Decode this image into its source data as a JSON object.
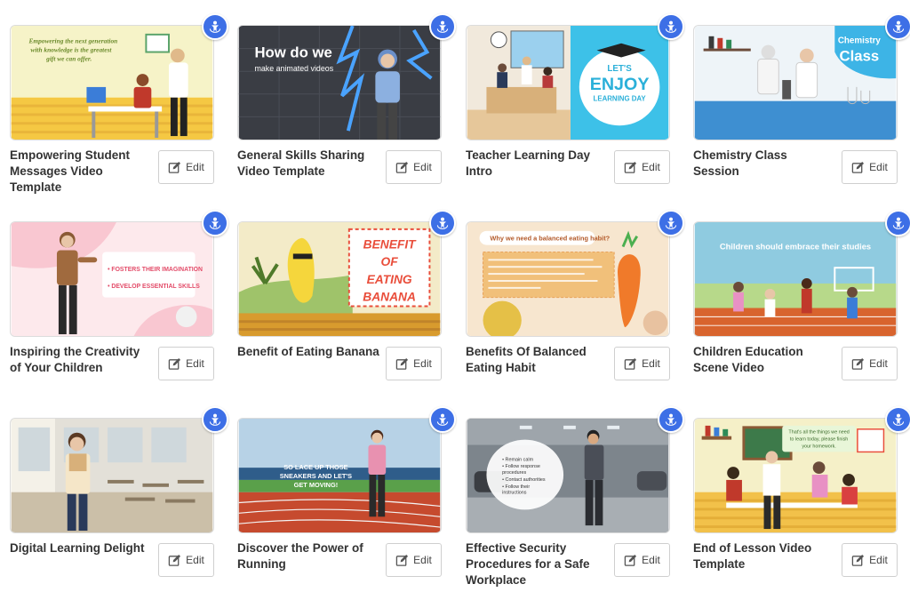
{
  "edit_label": "Edit",
  "colors": {
    "badge": "#3d6fe6",
    "border": "#dcdcdc"
  },
  "templates": [
    {
      "title": "Empowering Student Messages Video Template",
      "thumb_text": [
        "Empowering the next generation",
        "with knowledge is the greatest",
        "gift we can offer."
      ]
    },
    {
      "title": "General Skills Sharing Video Template",
      "thumb_text": [
        "How do we",
        "make animated videos"
      ]
    },
    {
      "title": "Teacher Learning Day Intro",
      "thumb_text": [
        "LET'S",
        "ENJOY",
        "LEARNING DAY"
      ]
    },
    {
      "title": "Chemistry Class Session",
      "thumb_text": [
        "Chemistry",
        "Class"
      ]
    },
    {
      "title": "Inspiring the Creativity of Your Children",
      "thumb_text": [
        "• FOSTERS THEIR IMAGINATION",
        "• DEVELOP ESSENTIAL SKILLS"
      ]
    },
    {
      "title": "Benefit of Eating Banana",
      "thumb_text": [
        "BENEFIT",
        "OF",
        "EATING",
        "BANANA"
      ]
    },
    {
      "title": "Benefits Of Balanced Eating Habit",
      "thumb_text": [
        "Why we need a balanced eating habit?"
      ]
    },
    {
      "title": "Children Education Scene Video",
      "thumb_text": [
        "Children should embrace their studies"
      ]
    },
    {
      "title": "Digital Learning Delight",
      "thumb_text": []
    },
    {
      "title": "Discover the Power of Running",
      "thumb_text": [
        "SO LACE UP THOSE",
        "SNEAKERS AND LET'S",
        "GET MOVING!"
      ]
    },
    {
      "title": "Effective Security Procedures for a Safe Workplace",
      "thumb_text": [
        "• Remain calm",
        "• Follow response",
        "  procedures",
        "• Contact authorities",
        "• Follow their",
        "  instructions"
      ]
    },
    {
      "title": "End of Lesson Video Template",
      "thumb_text": [
        "That's all the things we need",
        "to learn today, please finish",
        "your homework."
      ]
    }
  ]
}
